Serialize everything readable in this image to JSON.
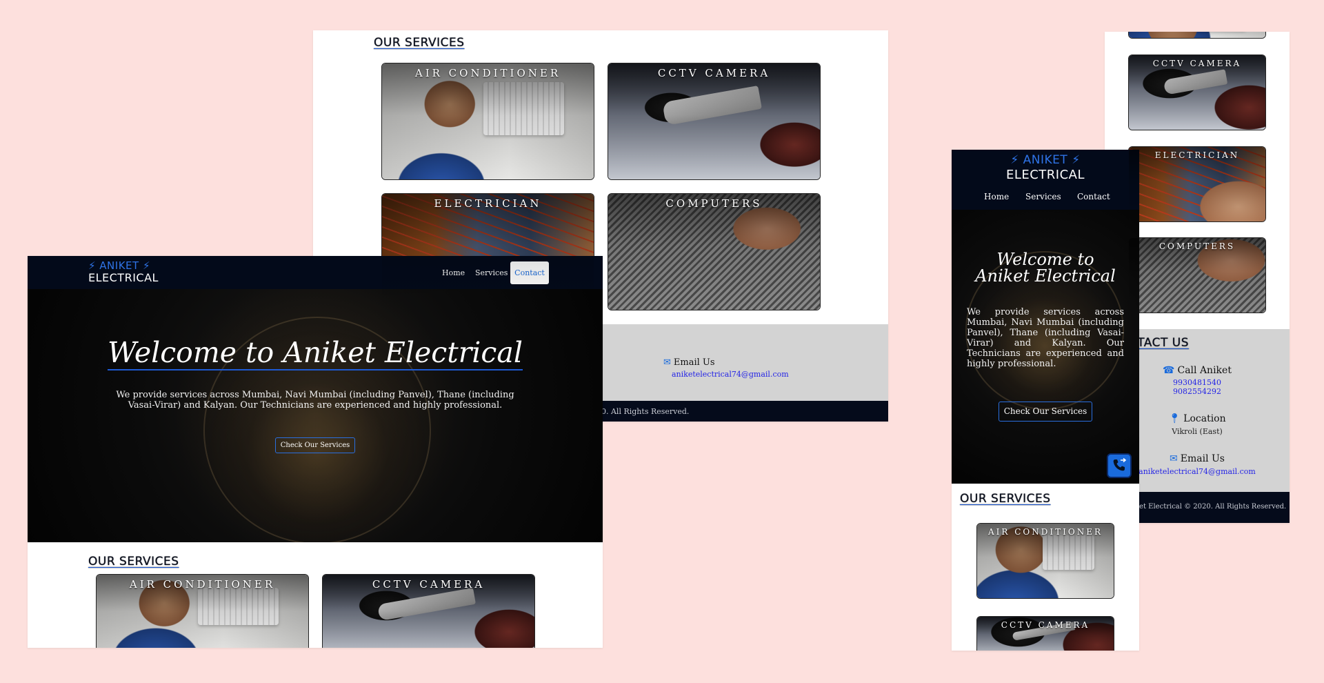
{
  "brand": {
    "line1": "⚡ ANIKET ⚡",
    "line2": "ELECTRICAL"
  },
  "nav": {
    "home": "Home",
    "services": "Services",
    "contact": "Contact"
  },
  "hero": {
    "title": "Welcome to Aniket Electrical",
    "title_mobile_line1": "Welcome to",
    "title_mobile_line2": "Aniket Electrical",
    "description": "We provide services across Mumbai, Navi Mumbai (including Panvel), Thane (including Vasai-Virar) and Kalyan. Our Technicians are experienced and highly professional.",
    "button": "Check Our Services"
  },
  "services": {
    "title": "OUR SERVICES",
    "items": [
      "AIR CONDITIONER",
      "CCTV CAMERA",
      "ELECTRICIAN",
      "COMPUTERS"
    ]
  },
  "contact": {
    "title": "CONTACT US",
    "title_clipped": "NTACT US",
    "call_label": "Call Aniket",
    "phones": [
      "9930481540",
      "9082554292"
    ],
    "location_label": "Location",
    "location_value": "Vikroli (East)",
    "email_label": "Email Us",
    "email": "aniketelectrical74@gmail.com"
  },
  "footer": {
    "text_clipped_b": "0. All Rights Reserved.",
    "text_clipped_d": "ket Electrical © 2020. All Rights Reserved."
  },
  "colors": {
    "page_bg": "#fde0dd",
    "nav_bg": "#030a1a",
    "accent": "#1a6bdc",
    "contact_bg": "#d3d3d3"
  }
}
